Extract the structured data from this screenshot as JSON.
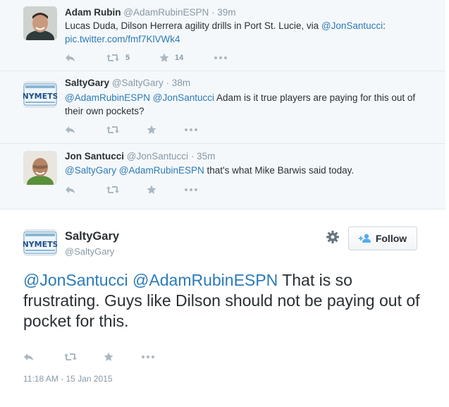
{
  "replies": [
    {
      "name": "Adam Rubin",
      "handle": "@AdamRubinESPN",
      "time": "· 39m",
      "text_plain": "Lucas Duda, Dilson Herrera agility drills in Port St. Lucie, via ",
      "text_mention": "@JonSantucci",
      "text_tail": ":",
      "text_link": "pic.twitter.com/fmf7KlVWk4",
      "retweets": "5",
      "favorites": "14"
    },
    {
      "name": "SaltyGary",
      "handle": "@SaltyGary",
      "time": "· 38m",
      "mention1": "@AdamRubinESPN",
      "mention2": "@JonSantucci",
      "text": " Adam is it true players are paying for this out of their own pockets?"
    },
    {
      "name": "Jon Santucci",
      "handle": "@JonSantucci",
      "time": "· 35m",
      "mention1": "@SaltyGary",
      "mention2": "@AdamRubinESPN",
      "text": " that's what Mike Barwis said today."
    }
  ],
  "main": {
    "name": "SaltyGary",
    "handle": "@SaltyGary",
    "follow_label": "Follow",
    "mention1": "@JonSantucci",
    "mention2": "@AdamRubinESPN",
    "text": " That is so frustrating. Guys like Dilson should not be paying out of pocket for this.",
    "timestamp": "11:18 AM - 15 Jan 2015"
  },
  "plate_text": "NYMETS",
  "colors": {
    "link": "#2b7bb9",
    "muted": "#8899a6",
    "icon": "#aab8c2"
  },
  "icons": [
    "reply-icon",
    "retweet-icon",
    "favorite-icon",
    "more-icon",
    "gear-icon",
    "follow-user-icon"
  ]
}
